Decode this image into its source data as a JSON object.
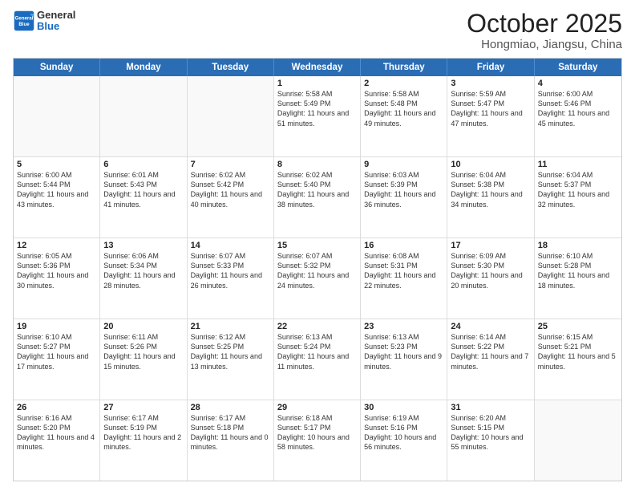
{
  "header": {
    "logo_general": "General",
    "logo_blue": "Blue",
    "title": "October 2025",
    "subtitle": "Hongmiao, Jiangsu, China"
  },
  "days_of_week": [
    "Sunday",
    "Monday",
    "Tuesday",
    "Wednesday",
    "Thursday",
    "Friday",
    "Saturday"
  ],
  "weeks": [
    [
      {
        "day": "",
        "info": ""
      },
      {
        "day": "",
        "info": ""
      },
      {
        "day": "",
        "info": ""
      },
      {
        "day": "1",
        "info": "Sunrise: 5:58 AM\nSunset: 5:49 PM\nDaylight: 11 hours and 51 minutes."
      },
      {
        "day": "2",
        "info": "Sunrise: 5:58 AM\nSunset: 5:48 PM\nDaylight: 11 hours and 49 minutes."
      },
      {
        "day": "3",
        "info": "Sunrise: 5:59 AM\nSunset: 5:47 PM\nDaylight: 11 hours and 47 minutes."
      },
      {
        "day": "4",
        "info": "Sunrise: 6:00 AM\nSunset: 5:46 PM\nDaylight: 11 hours and 45 minutes."
      }
    ],
    [
      {
        "day": "5",
        "info": "Sunrise: 6:00 AM\nSunset: 5:44 PM\nDaylight: 11 hours and 43 minutes."
      },
      {
        "day": "6",
        "info": "Sunrise: 6:01 AM\nSunset: 5:43 PM\nDaylight: 11 hours and 41 minutes."
      },
      {
        "day": "7",
        "info": "Sunrise: 6:02 AM\nSunset: 5:42 PM\nDaylight: 11 hours and 40 minutes."
      },
      {
        "day": "8",
        "info": "Sunrise: 6:02 AM\nSunset: 5:40 PM\nDaylight: 11 hours and 38 minutes."
      },
      {
        "day": "9",
        "info": "Sunrise: 6:03 AM\nSunset: 5:39 PM\nDaylight: 11 hours and 36 minutes."
      },
      {
        "day": "10",
        "info": "Sunrise: 6:04 AM\nSunset: 5:38 PM\nDaylight: 11 hours and 34 minutes."
      },
      {
        "day": "11",
        "info": "Sunrise: 6:04 AM\nSunset: 5:37 PM\nDaylight: 11 hours and 32 minutes."
      }
    ],
    [
      {
        "day": "12",
        "info": "Sunrise: 6:05 AM\nSunset: 5:36 PM\nDaylight: 11 hours and 30 minutes."
      },
      {
        "day": "13",
        "info": "Sunrise: 6:06 AM\nSunset: 5:34 PM\nDaylight: 11 hours and 28 minutes."
      },
      {
        "day": "14",
        "info": "Sunrise: 6:07 AM\nSunset: 5:33 PM\nDaylight: 11 hours and 26 minutes."
      },
      {
        "day": "15",
        "info": "Sunrise: 6:07 AM\nSunset: 5:32 PM\nDaylight: 11 hours and 24 minutes."
      },
      {
        "day": "16",
        "info": "Sunrise: 6:08 AM\nSunset: 5:31 PM\nDaylight: 11 hours and 22 minutes."
      },
      {
        "day": "17",
        "info": "Sunrise: 6:09 AM\nSunset: 5:30 PM\nDaylight: 11 hours and 20 minutes."
      },
      {
        "day": "18",
        "info": "Sunrise: 6:10 AM\nSunset: 5:28 PM\nDaylight: 11 hours and 18 minutes."
      }
    ],
    [
      {
        "day": "19",
        "info": "Sunrise: 6:10 AM\nSunset: 5:27 PM\nDaylight: 11 hours and 17 minutes."
      },
      {
        "day": "20",
        "info": "Sunrise: 6:11 AM\nSunset: 5:26 PM\nDaylight: 11 hours and 15 minutes."
      },
      {
        "day": "21",
        "info": "Sunrise: 6:12 AM\nSunset: 5:25 PM\nDaylight: 11 hours and 13 minutes."
      },
      {
        "day": "22",
        "info": "Sunrise: 6:13 AM\nSunset: 5:24 PM\nDaylight: 11 hours and 11 minutes."
      },
      {
        "day": "23",
        "info": "Sunrise: 6:13 AM\nSunset: 5:23 PM\nDaylight: 11 hours and 9 minutes."
      },
      {
        "day": "24",
        "info": "Sunrise: 6:14 AM\nSunset: 5:22 PM\nDaylight: 11 hours and 7 minutes."
      },
      {
        "day": "25",
        "info": "Sunrise: 6:15 AM\nSunset: 5:21 PM\nDaylight: 11 hours and 5 minutes."
      }
    ],
    [
      {
        "day": "26",
        "info": "Sunrise: 6:16 AM\nSunset: 5:20 PM\nDaylight: 11 hours and 4 minutes."
      },
      {
        "day": "27",
        "info": "Sunrise: 6:17 AM\nSunset: 5:19 PM\nDaylight: 11 hours and 2 minutes."
      },
      {
        "day": "28",
        "info": "Sunrise: 6:17 AM\nSunset: 5:18 PM\nDaylight: 11 hours and 0 minutes."
      },
      {
        "day": "29",
        "info": "Sunrise: 6:18 AM\nSunset: 5:17 PM\nDaylight: 10 hours and 58 minutes."
      },
      {
        "day": "30",
        "info": "Sunrise: 6:19 AM\nSunset: 5:16 PM\nDaylight: 10 hours and 56 minutes."
      },
      {
        "day": "31",
        "info": "Sunrise: 6:20 AM\nSunset: 5:15 PM\nDaylight: 10 hours and 55 minutes."
      },
      {
        "day": "",
        "info": ""
      }
    ]
  ]
}
